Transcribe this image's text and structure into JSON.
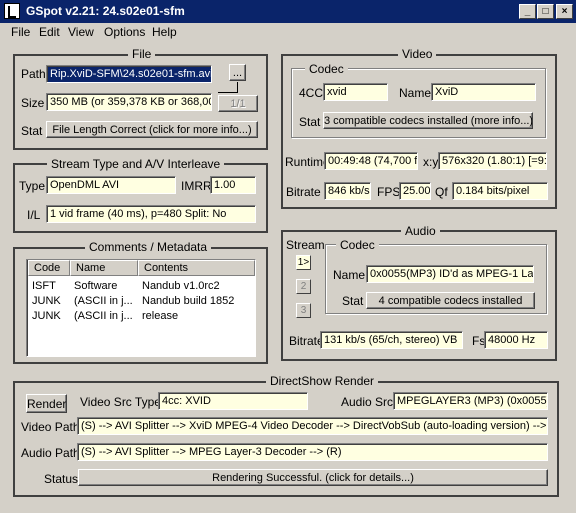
{
  "window": {
    "title": "GSpot v2.21: 24.s02e01-sfm"
  },
  "menu": [
    "File",
    "Edit",
    "View",
    "Options",
    "Help"
  ],
  "file": {
    "legend": "File",
    "path_label": "Path",
    "path_value": "Rip.XviD-SFM\\24.s02e01-sfm.avi",
    "browse_label": "...",
    "size_label": "Size",
    "size_value": "350 MB (or 359,378 KB or 368,00",
    "part_label": "1/1",
    "stat_label": "Stat",
    "stat_value": "File Length Correct (click for more info...)"
  },
  "stream_type": {
    "legend": "Stream Type and A/V Interleave",
    "type_label": "Type",
    "type_value": "OpenDML AVI",
    "imrr_label": "IMRR",
    "imrr_value": "1.00",
    "il_label": "I/L",
    "il_value": "1 vid frame (40 ms), p=480  Split: No"
  },
  "comments": {
    "legend": "Comments / Metadata",
    "columns": [
      "Code",
      "Name",
      "Contents"
    ],
    "rows": [
      {
        "code": "ISFT",
        "name": "Software",
        "contents": "Nandub v1.0rc2"
      },
      {
        "code": "JUNK",
        "name": "(ASCII in j...",
        "contents": "Nandub build 1852"
      },
      {
        "code": "JUNK",
        "name": "(ASCII in j...",
        "contents": "release"
      }
    ]
  },
  "video": {
    "legend": "Video",
    "codec_legend": "Codec",
    "fourcc_label": "4CC",
    "fourcc_value": "xvid",
    "name_label": "Name",
    "name_value": "XviD",
    "stat_label": "Stat",
    "stat_value": "3 compatible codecs installed (more info...)",
    "runtime_label": "Runtime",
    "runtime_value": "00:49:48 (74,700 fr",
    "xy_label": "x:y",
    "xy_value": "576x320 (1.80:1) [=9:",
    "bitrate_label": "Bitrate",
    "bitrate_value": "846 kb/s",
    "fps_label": "FPS",
    "fps_value": "25.00",
    "qf_label": "Qf",
    "qf_value": "0.184 bits/pixel"
  },
  "audio": {
    "legend": "Audio",
    "stream_label": "Stream",
    "streams": [
      "1>",
      "2",
      "3"
    ],
    "codec_legend": "Codec",
    "name_label": "Name",
    "name_value": "0x0055(MP3) ID'd as MPEG-1 Lay",
    "stat_label": "Stat",
    "stat_value": "4 compatible codecs installed",
    "bitrate_label": "Bitrate",
    "bitrate_value": "131 kb/s (65/ch, stereo) VB",
    "fs_label": "Fs",
    "fs_value": "48000 Hz"
  },
  "directshow": {
    "legend": "DirectShow Render",
    "render_button": "Render",
    "video_src_type_label": "Video Src Type",
    "video_src_type_value": "4cc: XVID",
    "audio_src_label": "Audio Src",
    "audio_src_value": "MPEGLAYER3 (MP3) (0x0055)",
    "video_path_label": "Video Path",
    "video_path_value": "(S) --> AVI Splitter --> XviD MPEG-4 Video Decoder --> DirectVobSub (auto-loading version) --> (R)",
    "audio_path_label": "Audio Path",
    "audio_path_value": "(S) --> AVI Splitter --> MPEG Layer-3 Decoder --> (R)",
    "status_label": "Status",
    "status_value": "Rendering Successful.  (click for details...)"
  }
}
